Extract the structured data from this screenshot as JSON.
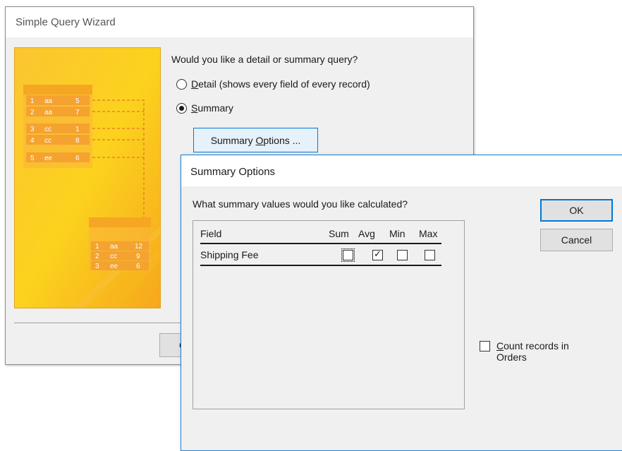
{
  "wizard": {
    "title": "Simple Query Wizard",
    "question": "Would you like a detail or summary query?",
    "options": [
      {
        "mnemonic": "D",
        "rest": "etail (shows every field of every record)",
        "selected": false
      },
      {
        "mnemonic": "S",
        "rest": "ummary",
        "selected": true
      }
    ],
    "summary_options_button": {
      "prefix": "Summary ",
      "mnemonic": "O",
      "suffix": "ptions ..."
    },
    "cancel_partial": "Ca",
    "illustration": {
      "source_rows": [
        [
          "1",
          "aa",
          "5"
        ],
        [
          "2",
          "aa",
          "7"
        ],
        [
          "3",
          "cc",
          "1"
        ],
        [
          "4",
          "cc",
          "8"
        ],
        [
          "5",
          "ee",
          "6"
        ]
      ],
      "result_rows": [
        [
          "1",
          "aa",
          "12"
        ],
        [
          "2",
          "cc",
          "9"
        ],
        [
          "3",
          "ee",
          "6"
        ]
      ]
    }
  },
  "summary_dialog": {
    "title": "Summary Options",
    "prompt": "What summary values would you like calculated?",
    "columns": {
      "field": "Field",
      "sum": "Sum",
      "avg": "Avg",
      "min": "Min",
      "max": "Max"
    },
    "rows": [
      {
        "field": "Shipping Fee",
        "sum": false,
        "avg": true,
        "min": false,
        "max": false
      }
    ],
    "ok_label": "OK",
    "cancel_label": "Cancel",
    "count_records": {
      "mnemonic": "C",
      "rest": "ount records in Orders",
      "checked": false
    }
  },
  "colors": {
    "accent": "#0078d7",
    "art_orange": "#f5a623",
    "art_yellow": "#fcd116"
  },
  "icons": [
    "radio-icon",
    "checkbox-icon",
    "check-mark-icon"
  ]
}
